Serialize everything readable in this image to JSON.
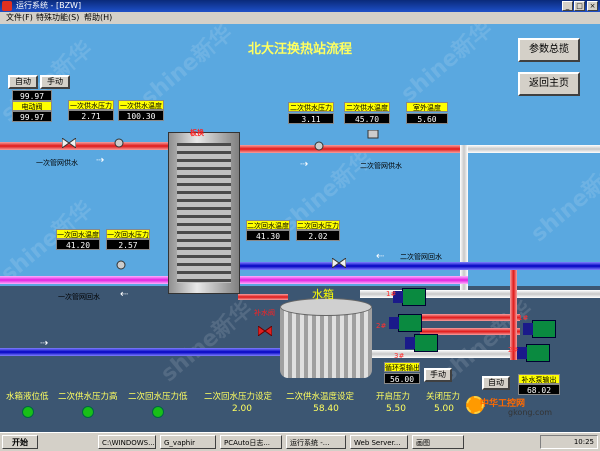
{
  "window": {
    "title": "运行系统 - [BZW]"
  },
  "menu": {
    "items": [
      "文件(F)",
      "特殊功能(S)",
      "帮助(H)"
    ]
  },
  "page_title": "北大汪换热站流程",
  "nav": {
    "overview": "参数总揽",
    "back_home": "返回主页"
  },
  "controls": {
    "auto1": "自动",
    "manual1": "手动",
    "auto2": "手动",
    "manual2": "自动"
  },
  "valve": {
    "label": "电动阀",
    "value1": "99.97",
    "value2": "99.97"
  },
  "primary": {
    "supply_pressure_label": "一次供水压力",
    "supply_pressure": "2.71",
    "supply_temp_label": "一次供水温度",
    "supply_temp": "100.30",
    "return_temp_label": "一次回水温度",
    "return_temp": "41.20",
    "return_pressure_label": "一次回水压力",
    "return_pressure": "2.57",
    "supply_pipe": "一次管网供水",
    "return_pipe": "一次管网回水"
  },
  "secondary": {
    "supply_pressure_label": "二次供水压力",
    "supply_pressure": "3.11",
    "supply_temp_label": "二次供水温度",
    "supply_temp": "45.70",
    "outdoor_temp_label": "室外温度",
    "outdoor_temp": "5.60",
    "return_temp_label": "二次回水温度",
    "return_temp": "41.30",
    "return_pressure_label": "二次回水压力",
    "return_pressure": "2.02",
    "supply_pipe": "二次管网供水",
    "return_pipe": "二次管网回水"
  },
  "hx_label": "板换",
  "tank_label": "水箱",
  "makeup_valve": "补水阀",
  "pumps": {
    "p1": "1#",
    "p2": "2#",
    "p3": "3#",
    "p4": "1#",
    "p5": "2#"
  },
  "circ_pump": {
    "label": "循环泵输出",
    "value": "56.00"
  },
  "makeup_pump": {
    "label": "补水泵输出",
    "value": "68.02"
  },
  "status": {
    "labels": [
      "水箱液位低",
      "二次供水压力高",
      "二次回水压力低",
      "二次回水压力设定",
      "二次供水温度设定",
      "开启压力",
      "关闭压力"
    ],
    "values": [
      "2.00",
      "58.40",
      "5.50",
      "5.00"
    ]
  },
  "taskbar": {
    "start": "开始",
    "tasks": [
      "C:\\WINDOWS...",
      "G_vaphir",
      "PCAuto日志...",
      "运行系统 -...",
      "Web Server...",
      "画图"
    ],
    "clock": "10:25"
  },
  "watermark": "shine新华",
  "brand": {
    "name": "中华工控网",
    "url": "gkong.com"
  },
  "colors": {
    "background": "#5aa8e0",
    "floor": "#3c5672",
    "title": "#ffff60",
    "hot_pipe": "#e01818",
    "cold_pipe": "#0000c0"
  }
}
